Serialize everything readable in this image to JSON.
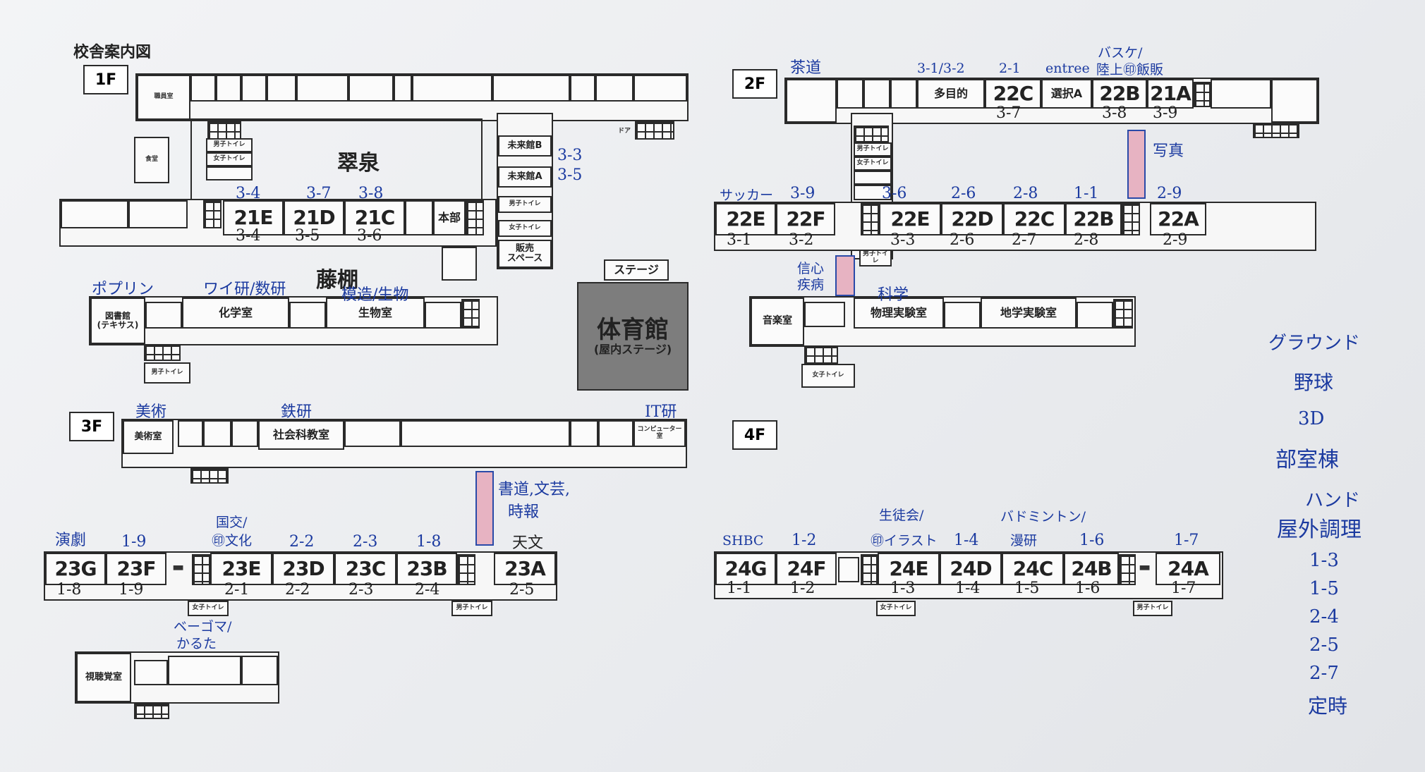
{
  "title": "校舎案内図",
  "floors": {
    "f1": "1F",
    "f2": "2F",
    "f3": "3F",
    "f4": "4F"
  },
  "f1": {
    "hall_large_1": "翠泉",
    "hall_large_2": "藤棚",
    "rooms": {
      "r21E": "21E",
      "r21D": "21D",
      "r21C": "21C",
      "honbu": "本部"
    },
    "mirai_b": "未来館B",
    "mirai_a": "未来館A",
    "hanbai": "販売\nスペース",
    "stage": "ステージ",
    "gym": "体育館",
    "gym_sub": "(屋内ステージ)",
    "chem": "化学室",
    "bio": "生物室",
    "textus": "図書館\n(テキサス)",
    "small": {
      "syoku": "食堂",
      "toilet_m": "男子トイレ",
      "toilet_f": "女子トイレ",
      "door": "ドア"
    },
    "hand": {
      "h21E_top": "3-4",
      "h21D_top": "3-7",
      "h21C_top": "3-8",
      "h21E_bot": "3-4",
      "h21D_bot": "3-5",
      "h21C_bot": "3-6",
      "mirai_b_note": "3-3",
      "mirai_a_note": "3-5",
      "poplin": "ポプリン",
      "chem_note": "ワイ研/数研",
      "bio_note": "模造/生物"
    }
  },
  "f2": {
    "rooms": {
      "r22C_top": "22C",
      "r22B_top": "22B",
      "r21A": "21A",
      "r22E_l": "22E",
      "r22F": "22F",
      "r22E": "22E",
      "r22D": "22D",
      "r22C": "22C",
      "r22B": "22B",
      "r22A": "22A"
    },
    "multi": "多目的",
    "select_a": "選択A",
    "music": "音楽室",
    "phys": "物理実験室",
    "earth": "地学実験室",
    "hand": {
      "sado": "茶道",
      "top_multi": "3-1/3-2",
      "top_22c": "2-1",
      "entree": "entree",
      "basket": "バスケ/",
      "rikujo": "陸上㊞飯販",
      "u22c": "3-7",
      "u22b": "3-8",
      "u21a": "3-9",
      "shashin": "写真",
      "soccer": "サッカー",
      "h22F": "3-9",
      "h22E": "3-6",
      "h22D": "2-6",
      "h22C": "2-8",
      "h22B": "1-1",
      "h22A": "2-9",
      "b22E_l": "3-1",
      "b22F": "3-2",
      "b22E": "3-3",
      "b22D": "2-6",
      "b22C": "2-7",
      "b22B": "2-8",
      "b22A": "2-9",
      "shinshin": "信心\n疾病",
      "kagaku": "科学"
    }
  },
  "f3": {
    "rooms": {
      "r23G": "23G",
      "r23F": "23F",
      "r23E": "23E",
      "r23D": "23D",
      "r23C": "23C",
      "r23B": "23B",
      "r23A": "23A"
    },
    "art": "美術室",
    "social": "社会科教室",
    "computer": "コンピューター室",
    "av": "視聴覚室",
    "hand": {
      "bijutsu": "美術",
      "tekken": "鉄研",
      "it": "IT研",
      "engeki": "演劇",
      "h23F": "1-9",
      "kokkou": "国交/",
      "bunka": "㊞文化",
      "h23D": "2-2",
      "h23C": "2-3",
      "h23B": "1-8",
      "shodo": "書道,文芸,",
      "jiho": "時報",
      "tenmon": "天文",
      "b23G": "1-8",
      "b23F": "1-9",
      "b23E": "2-1",
      "b23D": "2-2",
      "b23C": "2-3",
      "b23B": "2-4",
      "b23A": "2-5",
      "beigoma": "ベーゴマ/",
      "karuta": "かるた"
    }
  },
  "f4": {
    "rooms": {
      "r24G": "24G",
      "r24F": "24F",
      "r24E": "24E",
      "r24D": "24D",
      "r24C": "24C",
      "r24B": "24B",
      "r24A": "24A"
    },
    "hand": {
      "shbc": "SHBC",
      "h24F": "1-2",
      "seito": "生徒会/",
      "illust": "㊞イラスト",
      "h24D": "1-4",
      "badminton": "バドミントン/",
      "manken": "漫研",
      "h24B": "1-6",
      "h24A": "1-7",
      "b24G": "1-1",
      "b24F": "1-2",
      "b24E": "1-3",
      "b24D": "1-4",
      "b24C": "1-5",
      "b24B": "1-6",
      "b24A": "1-7"
    }
  },
  "side_notes": [
    "グラウンド",
    "野球",
    "3D",
    "部室棟",
    "ハンド",
    "屋外調理",
    "1-3",
    "1-5",
    "2-4",
    "2-5",
    "2-7",
    "定時"
  ]
}
